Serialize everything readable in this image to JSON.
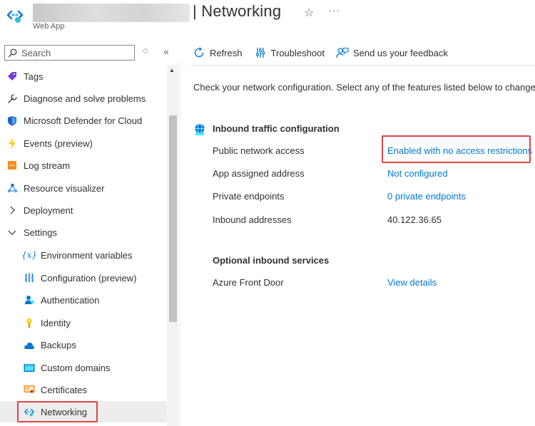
{
  "header": {
    "title": "| Networking",
    "subtitle": "Web App",
    "favorite_icon": "star-icon",
    "more_icon": "more-icon"
  },
  "sidebar": {
    "search": {
      "placeholder": "Search",
      "value": ""
    },
    "items": [
      {
        "label": "Tags",
        "icon": "tag-icon"
      },
      {
        "label": "Diagnose and solve problems",
        "icon": "wrench-icon"
      },
      {
        "label": "Microsoft Defender for Cloud",
        "icon": "shield-icon"
      },
      {
        "label": "Events (preview)",
        "icon": "lightning-icon"
      },
      {
        "label": "Log stream",
        "icon": "log-stream-icon"
      },
      {
        "label": "Resource visualizer",
        "icon": "resource-visualizer-icon"
      },
      {
        "label": "Deployment",
        "icon": "chevron-right-icon"
      },
      {
        "label": "Settings",
        "icon": "chevron-down-icon"
      },
      {
        "label": "Environment variables",
        "icon": "variable-icon"
      },
      {
        "label": "Configuration (preview)",
        "icon": "configuration-icon"
      },
      {
        "label": "Authentication",
        "icon": "authentication-icon"
      },
      {
        "label": "Identity",
        "icon": "identity-icon"
      },
      {
        "label": "Backups",
        "icon": "backup-icon"
      },
      {
        "label": "Custom domains",
        "icon": "custom-domains-icon"
      },
      {
        "label": "Certificates",
        "icon": "certificate-icon"
      },
      {
        "label": "Networking",
        "icon": "networking-icon",
        "selected": true
      }
    ]
  },
  "toolbar": {
    "refresh": "Refresh",
    "troubleshoot": "Troubleshoot",
    "feedback": "Send us your feedback"
  },
  "main": {
    "intro": "Check your network configuration. Select any of the features listed below to change",
    "inbound": {
      "title": "Inbound traffic configuration",
      "rows": [
        {
          "label": "Public network access",
          "value": "Enabled with no access restrictions",
          "link": true
        },
        {
          "label": "App assigned address",
          "value": "Not configured",
          "link": true
        },
        {
          "label": "Private endpoints",
          "value": "0 private endpoints",
          "link": true
        },
        {
          "label": "Inbound addresses",
          "value": "40.122.36.65",
          "link": false
        }
      ]
    },
    "optional": {
      "title": "Optional inbound services",
      "rows": [
        {
          "label": "Azure Front Door",
          "value": "View details",
          "link": true
        }
      ]
    }
  },
  "colors": {
    "accent": "#0078d4",
    "highlight": "#e04545",
    "selected_bg": "#ededed"
  }
}
